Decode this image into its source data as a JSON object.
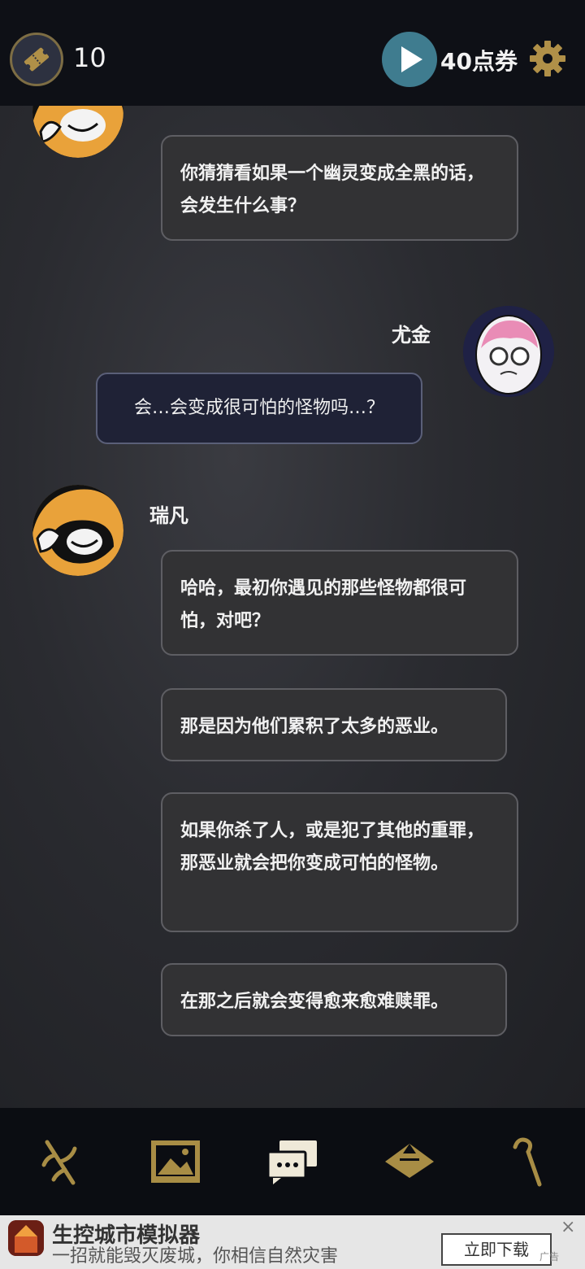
{
  "header": {
    "ticket_icon": "ticket-icon",
    "ticket_count": "10",
    "play_icon": "play-icon",
    "coupon_text": "40点券",
    "settings_icon": "gear-icon",
    "accent_gold": "#b09048",
    "play_color": "#3f7c8f"
  },
  "chat": {
    "messages": [
      {
        "speaker": "",
        "text": "你猜猜看如果一个幽灵变成全黑的话，会发生什么事？"
      },
      {
        "speaker": "尤金",
        "text": "会…会变成很可怕的怪物吗…？"
      },
      {
        "speaker": "瑞凡",
        "text": "哈哈，最初你遇见的那些怪物都很可怕，对吧？"
      },
      {
        "speaker": "",
        "text": "那是因为他们累积了太多的恶业。"
      },
      {
        "speaker": "",
        "text": "如果你杀了人，或是犯了其他的重罪，那恶业就会把你变成可怕的怪物。"
      },
      {
        "speaker": "",
        "text": "在那之后就会变得愈来愈难赎罪。"
      }
    ]
  },
  "nav": {
    "items": [
      {
        "icon": "branch-icon"
      },
      {
        "icon": "picture-icon"
      },
      {
        "icon": "chat-icon"
      },
      {
        "icon": "hat-icon"
      },
      {
        "icon": "cane-icon"
      }
    ]
  },
  "ad": {
    "title": "生控城市模拟器",
    "subtitle": "一招就能毁灭废城，你相信自然灾害",
    "button": "立即下载",
    "close": "×",
    "mark": "广告"
  }
}
